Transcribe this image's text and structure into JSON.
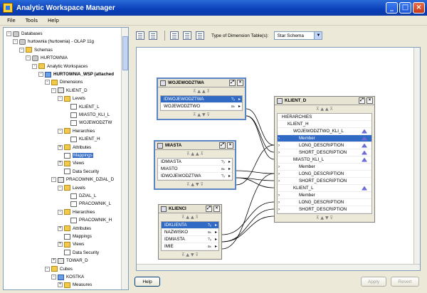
{
  "window": {
    "title": "Analytic Workspace Manager"
  },
  "menu": {
    "file": "File",
    "tools": "Tools",
    "help": "Help"
  },
  "tree": [
    {
      "label": "Databases",
      "indent": 0,
      "exp": "-",
      "icon": "db"
    },
    {
      "label": "hurtownia (hurtownia) - OLAP 11g",
      "indent": 1,
      "exp": "-",
      "icon": "db"
    },
    {
      "label": "Schemas",
      "indent": 2,
      "exp": "-",
      "icon": "folder"
    },
    {
      "label": "HURTOWNIA",
      "indent": 3,
      "exp": "-",
      "icon": "db"
    },
    {
      "label": "Analytic Workspaces",
      "indent": 4,
      "exp": "-",
      "icon": "folder"
    },
    {
      "label": "HURTOWNIA_WSP (attached",
      "indent": 5,
      "exp": "-",
      "icon": "cube",
      "bold": true
    },
    {
      "label": "Dimensions",
      "indent": 6,
      "exp": "-",
      "icon": "folder"
    },
    {
      "label": "KLIENT_D",
      "indent": 7,
      "exp": "-",
      "icon": "dim"
    },
    {
      "label": "Levels",
      "indent": 8,
      "exp": "-",
      "icon": "folder"
    },
    {
      "label": "KLIENT_L",
      "indent": 9,
      "exp": "",
      "icon": "doc"
    },
    {
      "label": "MIASTO_KLI_L",
      "indent": 9,
      "exp": "",
      "icon": "doc"
    },
    {
      "label": "WOJEWODZTW",
      "indent": 9,
      "exp": "",
      "icon": "doc"
    },
    {
      "label": "Hierarchies",
      "indent": 8,
      "exp": "-",
      "icon": "folder"
    },
    {
      "label": "KLIENT_H",
      "indent": 9,
      "exp": "",
      "icon": "doc"
    },
    {
      "label": "Attributes",
      "indent": 8,
      "exp": "+",
      "icon": "folder"
    },
    {
      "label": "Mappings",
      "indent": 8,
      "exp": "",
      "icon": "doc",
      "selected": true
    },
    {
      "label": "Views",
      "indent": 8,
      "exp": "+",
      "icon": "folder"
    },
    {
      "label": "Data Security",
      "indent": 8,
      "exp": "",
      "icon": "doc"
    },
    {
      "label": "PRACOWNIK_DZIAL_D",
      "indent": 7,
      "exp": "-",
      "icon": "dim"
    },
    {
      "label": "Levels",
      "indent": 8,
      "exp": "-",
      "icon": "folder"
    },
    {
      "label": "DZIAL_L",
      "indent": 9,
      "exp": "",
      "icon": "doc"
    },
    {
      "label": "PRACOWNIK_L",
      "indent": 9,
      "exp": "",
      "icon": "doc"
    },
    {
      "label": "Hierarchies",
      "indent": 8,
      "exp": "-",
      "icon": "folder"
    },
    {
      "label": "PRACOWNIK_H",
      "indent": 9,
      "exp": "",
      "icon": "doc"
    },
    {
      "label": "Attributes",
      "indent": 8,
      "exp": "+",
      "icon": "folder"
    },
    {
      "label": "Mappings",
      "indent": 8,
      "exp": "",
      "icon": "doc"
    },
    {
      "label": "Views",
      "indent": 8,
      "exp": "+",
      "icon": "folder"
    },
    {
      "label": "Data Security",
      "indent": 8,
      "exp": "",
      "icon": "doc"
    },
    {
      "label": "TOWAR_D",
      "indent": 7,
      "exp": "+",
      "icon": "dim"
    },
    {
      "label": "Cubes",
      "indent": 6,
      "exp": "-",
      "icon": "folder"
    },
    {
      "label": "KOSTKA",
      "indent": 7,
      "exp": "-",
      "icon": "cube"
    },
    {
      "label": "Measures",
      "indent": 8,
      "exp": "+",
      "icon": "folder"
    }
  ],
  "toolbar": {
    "type_label": "Type of Dimension Table(s):",
    "type_value": "Star Schema"
  },
  "boxes": {
    "wojewodztwa": {
      "title": "WOJEWODZTWA",
      "rows": [
        {
          "name": "IDWOJEWODZTWA",
          "type": "?₉",
          "sel": true
        },
        {
          "name": "WOJEWODZTWO",
          "type": "aₕ"
        }
      ]
    },
    "miasta": {
      "title": "MIASTA",
      "rows": [
        {
          "name": "IDMIASTA",
          "type": "?₉"
        },
        {
          "name": "MIASTO",
          "type": "aₕ"
        },
        {
          "name": "IDWOJEWODZTWA",
          "type": "?₉"
        }
      ]
    },
    "klienci": {
      "title": "KLIENCI",
      "rows": [
        {
          "name": "IDKLIENTA",
          "type": "?₉",
          "sel": true
        },
        {
          "name": "NAZWISKO",
          "type": "aₕ"
        },
        {
          "name": "IDMIASTA",
          "type": "?₉"
        },
        {
          "name": "IMIE",
          "type": "aₕ"
        }
      ]
    },
    "klient_d": {
      "title": "KLIENT_D",
      "rows": [
        {
          "name": "HIERARCHIES",
          "ind": 0,
          "arrow": false
        },
        {
          "name": "KLIENT_H",
          "ind": 1,
          "arrow": false
        },
        {
          "name": "WOJEWODZTWO_KLI_L",
          "ind": 2,
          "arrow": false,
          "tri": true
        },
        {
          "name": "Member",
          "ind": 3,
          "arrow": true,
          "sel": true,
          "tri": true
        },
        {
          "name": "LONG_DESCRIPTION",
          "ind": 3,
          "arrow": true,
          "tri": true
        },
        {
          "name": "SHORT_DESCRIPTION",
          "ind": 3,
          "arrow": true,
          "tri": true
        },
        {
          "name": "MIASTO_KLI_L",
          "ind": 2,
          "arrow": false,
          "tri": true
        },
        {
          "name": "Member",
          "ind": 3,
          "arrow": true
        },
        {
          "name": "LONG_DESCRIPTION",
          "ind": 3,
          "arrow": true
        },
        {
          "name": "SHORT_DESCRIPTION",
          "ind": 3,
          "arrow": true
        },
        {
          "name": "KLIENT_L",
          "ind": 2,
          "arrow": false,
          "tri": true
        },
        {
          "name": "Member",
          "ind": 3,
          "arrow": true
        },
        {
          "name": "LONG_DESCRIPTION",
          "ind": 3,
          "arrow": true
        },
        {
          "name": "SHORT_DESCRIPTION",
          "ind": 3,
          "arrow": true
        }
      ]
    }
  },
  "buttons": {
    "help": "Help",
    "apply": "Apply",
    "revert": "Revert"
  }
}
